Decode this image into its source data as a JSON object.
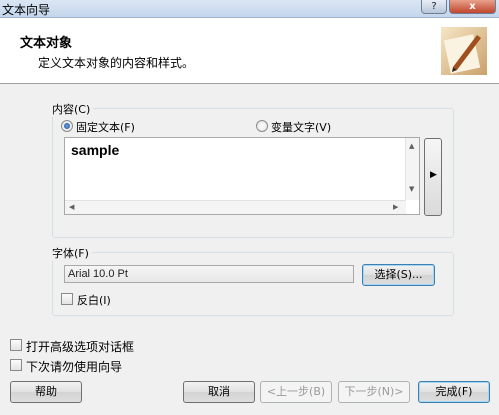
{
  "window": {
    "title": "文本向导",
    "help_label": "?",
    "close_label": "x"
  },
  "header": {
    "title": "文本对象",
    "subtitle": "定义文本对象的内容和样式。"
  },
  "content_group": {
    "label": "内容(C)",
    "radio_fixed": "固定文本(F)",
    "radio_variable": "变量文字(V)",
    "selected": "fixed",
    "text_value": "sample"
  },
  "font_group": {
    "label": "字体(F)",
    "font_value": "Arial 10.0 Pt",
    "select_button": "选择(S)...",
    "reverse_label": "反白(I)"
  },
  "options": {
    "advanced_label": "打开高级选项对话框",
    "no_wizard_label": "下次请勿使用向导"
  },
  "footer": {
    "help": "帮助",
    "cancel": "取消",
    "prev": "<上一步(B)",
    "next": "下一步(N)>",
    "finish": "完成(F)"
  }
}
